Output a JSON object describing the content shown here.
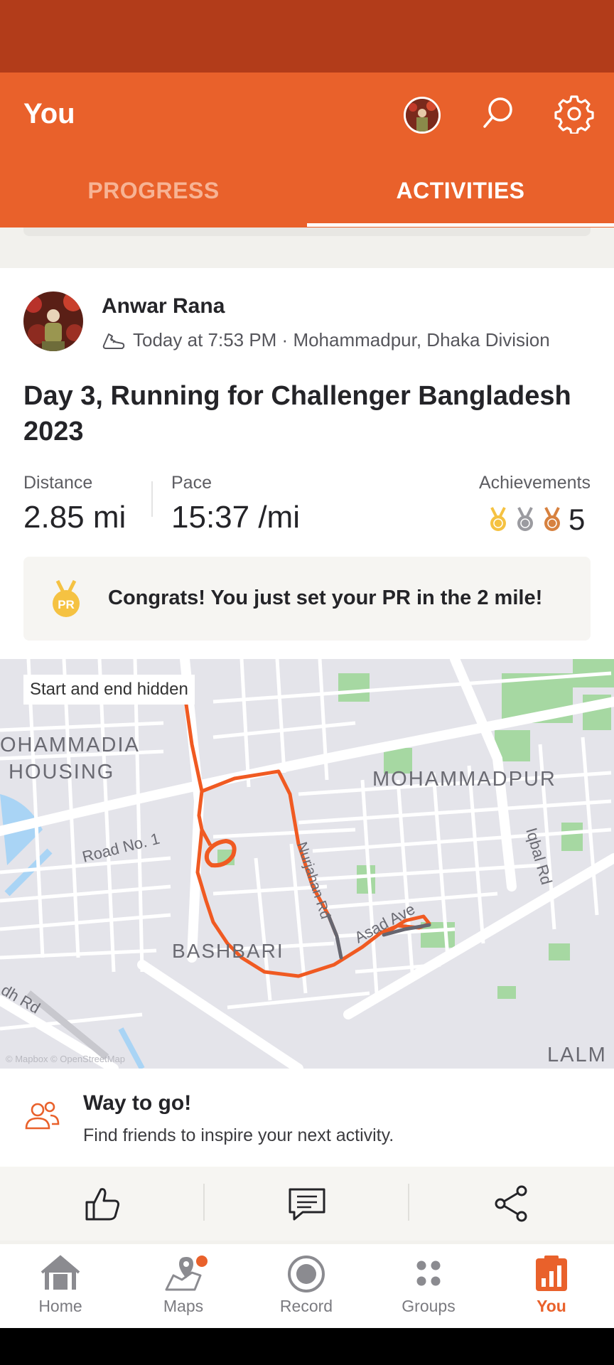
{
  "header": {
    "title": "You",
    "tabs": [
      {
        "label": "PROGRESS",
        "active": false
      },
      {
        "label": "ACTIVITIES",
        "active": true
      }
    ],
    "icons": [
      "avatar",
      "search-icon",
      "gear-icon"
    ]
  },
  "activity": {
    "athlete_name": "Anwar Rana",
    "meta": "Today at 7:53 PM · Mohammadpur, Dhaka Division",
    "title": "Day 3, Running for Challenger Bangladesh 2023",
    "stats": {
      "distance_label": "Distance",
      "distance_value": "2.85 mi",
      "pace_label": "Pace",
      "pace_value": "15:37 /mi",
      "achievements_label": "Achievements",
      "achievements_count": "5"
    },
    "pr_text": "Congrats! You just set your PR in the 2 mile!",
    "pr_icon_text": "PR"
  },
  "map": {
    "overlay_label": "Start and end hidden",
    "labels": {
      "mohammadia": "OHAMMADIA",
      "housing": "HOUSING",
      "mohammadpur": "MOHAMMADPUR",
      "road_no_1": "Road No. 1",
      "bashbari": "BASHBARI",
      "iqbal_rd": "Iqbal Rd",
      "asad_ave": "Asad Ave",
      "lalm": "LALM",
      "dh_rd": "dh Rd",
      "nurjahan_rd": "Nurjahan Rd",
      "attribution": "© Mapbox © OpenStreetMap"
    }
  },
  "way_to_go": {
    "title": "Way to go!",
    "subtitle": "Find friends to inspire your next activity."
  },
  "bottom_nav": [
    {
      "label": "Home",
      "icon": "home-icon"
    },
    {
      "label": "Maps",
      "icon": "maps-icon"
    },
    {
      "label": "Record",
      "icon": "record-icon"
    },
    {
      "label": "Groups",
      "icon": "groups-icon"
    },
    {
      "label": "You",
      "icon": "you-icon",
      "active": true
    }
  ],
  "colors": {
    "brand": "#e9612b",
    "status_bar": "#b23c1a",
    "route": "#f05a22"
  }
}
